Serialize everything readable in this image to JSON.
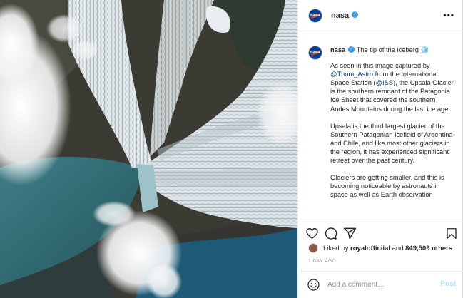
{
  "header": {
    "username": "nasa",
    "verified_icon": "verified-badge-icon",
    "more_icon": "more-options-icon",
    "more_glyph": "•••"
  },
  "caption": {
    "username": "nasa",
    "title": "The tip of the iceberg 🧊",
    "p1_before": "As seen in this image captured by ",
    "p1_mention1": "@Thom_Astro",
    "p1_middle": " from the International Space Station (",
    "p1_mention2": "@ISS",
    "p1_after": "), the Upsala Glacier is the southern remnant of the Patagonia Ice Sheet that covered the southern Andes Mountains during the last ice age.",
    "p2": "Upsala is the third largest glacier of the Southern Patagonian Icefield of Argentina and Chile, and like most other glaciers in the region, it has experienced significant retreat over the past century.",
    "p3": "Glaciers are getting smaller, and this is becoming noticeable by astronauts in space as well as Earth observation"
  },
  "actions": {
    "like_icon": "heart-icon",
    "comment_icon": "comment-icon",
    "share_icon": "share-icon",
    "save_icon": "bookmark-icon"
  },
  "likes": {
    "prefix": "Liked by ",
    "user": "royalofficiial",
    "middle": " and ",
    "count": "849,509 others"
  },
  "timestamp": "1 DAY AGO",
  "comment_box": {
    "emoji_icon": "emoji-icon",
    "placeholder": "Add a comment…",
    "post_label": "Post"
  },
  "colors": {
    "link": "#00376b",
    "verified": "#3897f0",
    "post_disabled": "#b2dffc",
    "muted": "#8e8e8e"
  }
}
